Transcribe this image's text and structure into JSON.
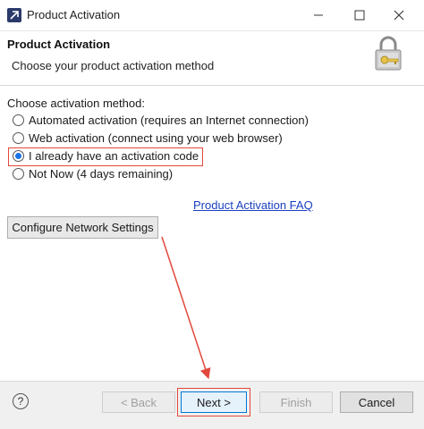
{
  "window": {
    "title": "Product Activation",
    "minimize_icon": "minimize-icon",
    "maximize_icon": "maximize-icon",
    "close_icon": "close-icon"
  },
  "header": {
    "title": "Product Activation",
    "subtitle": "Choose your product activation method",
    "icon": "lock-key-icon"
  },
  "method": {
    "label": "Choose activation method:",
    "options": [
      {
        "label": "Automated activation (requires an Internet connection)",
        "checked": false
      },
      {
        "label": "Web activation (connect using your web browser)",
        "checked": false
      },
      {
        "label": "I already have an activation code",
        "checked": true
      },
      {
        "label": "Not Now (4 days remaining)",
        "checked": false
      }
    ]
  },
  "links": {
    "faq": "Product Activation FAQ"
  },
  "buttons": {
    "configure_network": "Configure Network Settings",
    "help_icon": "help-icon",
    "help_glyph": "?",
    "back": "< Back",
    "next": "Next >",
    "finish": "Finish",
    "cancel": "Cancel"
  },
  "colors": {
    "annotation_red": "#e2483b",
    "link_blue": "#1a3fbf",
    "radio_selected": "#1a73e8"
  }
}
